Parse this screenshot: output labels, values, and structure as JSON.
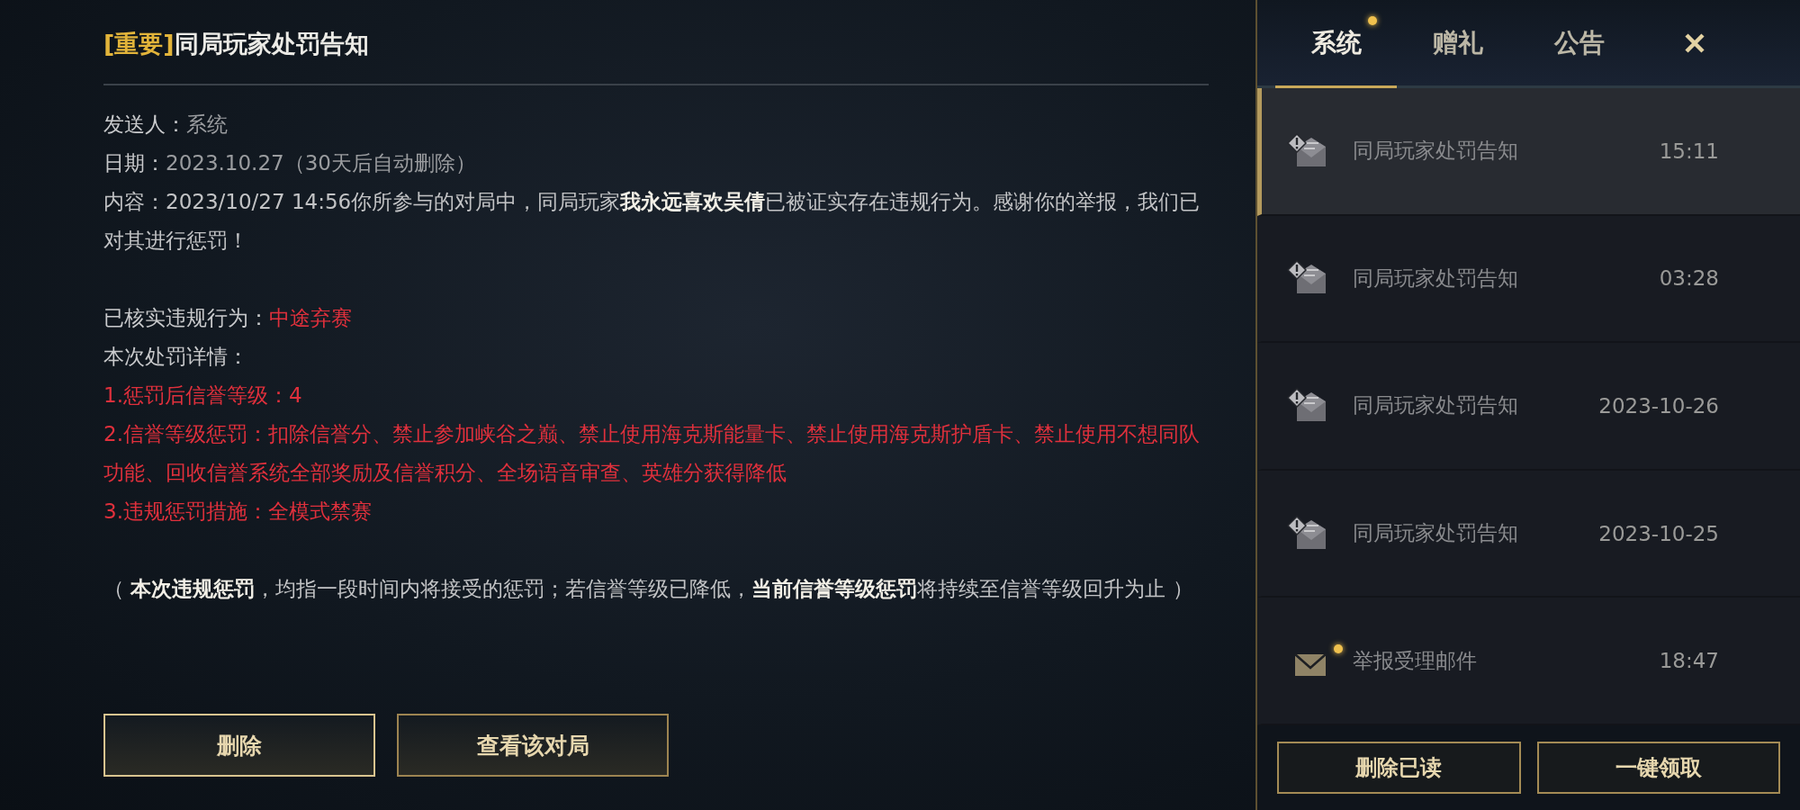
{
  "message": {
    "tag": "[重要]",
    "title": "同局玩家处罚告知",
    "sender_label": "发送人：",
    "sender": "系统",
    "date_label": "日期：",
    "date": "2023.10.27（30天后自动删除）",
    "content": "内容：2023/10/27 14:56你所参与的对局中，同局玩家**我永远喜欢吴倩**已被证实存在违规行为。感谢你的举报，我们已对其进行惩罚！",
    "violation_label": "已核实违规行为：",
    "violation": "中途弃赛",
    "details_label": "本次处罚详情：",
    "penalties": [
      "1.惩罚后信誉等级：4",
      "2.信誉等级惩罚：扣除信誉分、禁止参加峡谷之巅、禁止使用海克斯能量卡、禁止使用海克斯护盾卡、禁止使用不想同队功能、回收信誉系统全部奖励及信誉积分、全场语音审查、英雄分获得降低",
      "3.违规惩罚措施：全模式禁赛"
    ],
    "note": "（ **本次违规惩罚**，均指一段时间内将接受的惩罚；若信誉等级已降低，**当前信誉等级惩罚**将持续至信誉等级回升为止 ）"
  },
  "actions": [
    "删除",
    "查看该对局"
  ],
  "tabs": [
    {
      "label": "系统",
      "selected": true,
      "unread": true
    },
    {
      "label": "赠礼",
      "selected": false,
      "unread": false
    },
    {
      "label": "公告",
      "selected": false,
      "unread": false
    }
  ],
  "mails": [
    {
      "kind": "penalty",
      "title": "同局玩家处罚告知",
      "time": "15:11",
      "selected": true,
      "unread": false
    },
    {
      "kind": "penalty",
      "title": "同局玩家处罚告知",
      "time": "03:28",
      "selected": false,
      "unread": false
    },
    {
      "kind": "penalty",
      "title": "同局玩家处罚告知",
      "time": "2023-10-26",
      "selected": false,
      "unread": false
    },
    {
      "kind": "penalty",
      "title": "同局玩家处罚告知",
      "time": "2023-10-25",
      "selected": false,
      "unread": false
    },
    {
      "kind": "report",
      "title": "举报受理邮件",
      "time": "18:47",
      "selected": false,
      "unread": true
    }
  ],
  "list_actions": [
    "删除已读",
    "一键领取"
  ]
}
